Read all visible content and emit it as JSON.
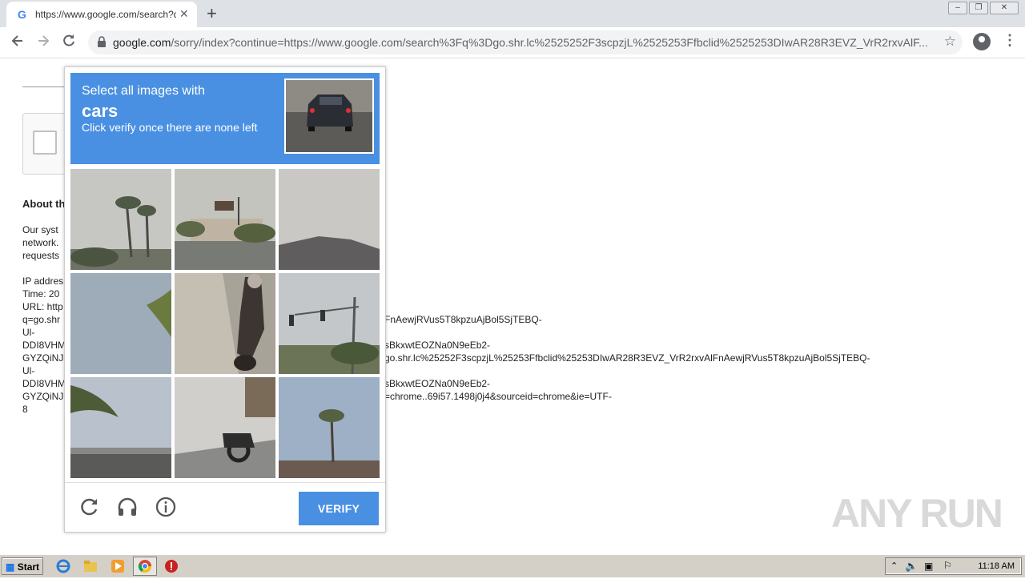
{
  "browser": {
    "tab_title": "https://www.google.com/search?q=",
    "tab_close": "✕",
    "new_tab": "+",
    "url_host": "google.com",
    "url_rest": "/sorry/index?continue=https://www.google.com/search%3Fq%3Dgo.shr.lc%2525252F3scpzjL%2525253Ffbclid%2525253DIwAR28R3EVZ_VrR2rxvAlF...",
    "star": "☆",
    "menu": "⋮"
  },
  "page": {
    "about_heading": "About th",
    "paragraph": "Our syst\nnetwork.\nrequests",
    "details_left": "IP addres\nTime: 20\nURL: http\nq=go.shr\nUl-\nDDI8VHM\nGYZQiNJ\nUl-\nDDI8VHM\nGYZQiNJ\n8",
    "details_right_1": "FnAewjRVus5T8kpzuAjBol5SjTEBQ-",
    "details_right_2": "sBkxwtEOZNa0N9eEb2-",
    "details_right_3": "go.shr.lc%25252F3scpzjL%25253Ffbclid%25253DIwAR28R3EVZ_VrR2rxvAlFnAewjRVus5T8kpzuAjBol5SjTEBQ-",
    "details_right_4": "sBkxwtEOZNa0N9eEb2-",
    "details_right_5": "=chrome..69i57.1498j0j4&sourceid=chrome&ie=UTF-"
  },
  "captcha": {
    "line1": "Select all images with",
    "line2": "cars",
    "line3": "Click verify once there are none left",
    "verify_label": "VERIFY"
  },
  "watermark": "ANY RUN",
  "taskbar": {
    "start": "Start",
    "clock": "11:18 AM"
  }
}
